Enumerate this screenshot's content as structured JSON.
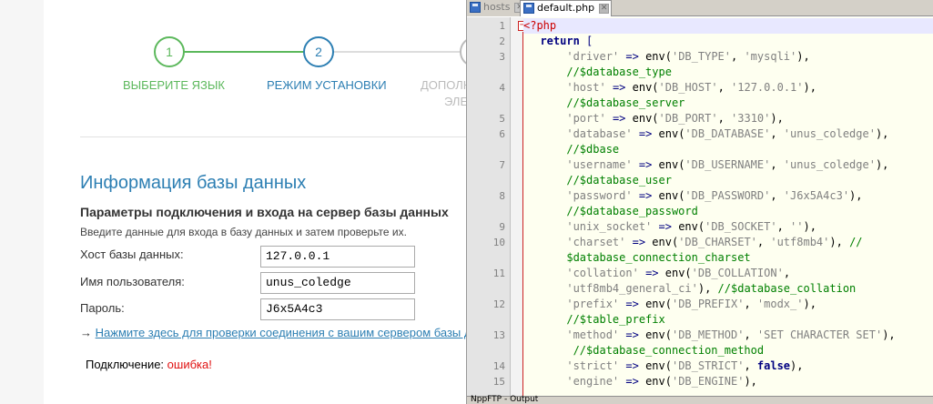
{
  "installer": {
    "steps": [
      {
        "number": "1",
        "label": "ВЫБЕРИТЕ ЯЗЫК",
        "state": "done",
        "color": "#5cb85c"
      },
      {
        "number": "2",
        "label": "РЕЖИМ УСТАНОВКИ",
        "state": "current",
        "color": "#2d7fb3"
      },
      {
        "number": "",
        "label": "ДОПОЛН",
        "label_line2": "ЭЛЕ",
        "state": "pending",
        "color": "#bbbbbb"
      }
    ],
    "section_title": "Информация базы данных",
    "section_subtitle": "Параметры подключения и входа на сервер базы данных",
    "section_description": "Введите данные для входа в базу данных и затем проверьте их.",
    "fields": [
      {
        "label": "Хост базы данных:",
        "value": "127.0.0.1"
      },
      {
        "label": "Имя пользователя:",
        "value": "unus_coledge"
      },
      {
        "label": "Пароль:",
        "value": "J6x5A4c3"
      }
    ],
    "check_arrow": "→",
    "check_link": "Нажмите здесь для проверки соединения с вашим сервером базы дан",
    "status_label": "Подключение:",
    "status_value": "ошибка!",
    "status_color": "#e01010"
  },
  "editor": {
    "tabs": [
      {
        "name": "hosts",
        "active": false
      },
      {
        "name": "default.php",
        "active": true
      }
    ],
    "close_glyph": "✕",
    "fold_glyph": "−",
    "lines": [
      {
        "num": "1",
        "tokens": [
          [
            "t-tag",
            "<?php"
          ]
        ]
      },
      {
        "num": "2",
        "tokens": [
          [
            "t-plain",
            "  "
          ],
          [
            "t-kw",
            "return"
          ],
          [
            "t-plain",
            " "
          ],
          [
            "t-op",
            "["
          ]
        ]
      },
      {
        "num": "3",
        "tokens": [
          [
            "t-plain",
            "      "
          ],
          [
            "t-str",
            "'driver'"
          ],
          [
            "t-plain",
            " "
          ],
          [
            "t-op",
            "=>"
          ],
          [
            "t-plain",
            " env("
          ],
          [
            "t-str",
            "'DB_TYPE'"
          ],
          [
            "t-plain",
            ", "
          ],
          [
            "t-str",
            "'mysqli'"
          ],
          [
            "t-plain",
            "),"
          ]
        ]
      },
      {
        "num": "",
        "tokens": [
          [
            "t-plain",
            "      "
          ],
          [
            "t-cmt",
            "//$database_type"
          ]
        ]
      },
      {
        "num": "4",
        "tokens": [
          [
            "t-plain",
            "      "
          ],
          [
            "t-str",
            "'host'"
          ],
          [
            "t-plain",
            " "
          ],
          [
            "t-op",
            "=>"
          ],
          [
            "t-plain",
            " env("
          ],
          [
            "t-str",
            "'DB_HOST'"
          ],
          [
            "t-plain",
            ", "
          ],
          [
            "t-str",
            "'127.0.0.1'"
          ],
          [
            "t-plain",
            "),"
          ]
        ]
      },
      {
        "num": "",
        "tokens": [
          [
            "t-plain",
            "      "
          ],
          [
            "t-cmt",
            "//$database_server"
          ]
        ]
      },
      {
        "num": "5",
        "tokens": [
          [
            "t-plain",
            "      "
          ],
          [
            "t-str",
            "'port'"
          ],
          [
            "t-plain",
            " "
          ],
          [
            "t-op",
            "=>"
          ],
          [
            "t-plain",
            " env("
          ],
          [
            "t-str",
            "'DB_PORT'"
          ],
          [
            "t-plain",
            ", "
          ],
          [
            "t-str",
            "'3310'"
          ],
          [
            "t-plain",
            "),"
          ]
        ]
      },
      {
        "num": "6",
        "tokens": [
          [
            "t-plain",
            "      "
          ],
          [
            "t-str",
            "'database'"
          ],
          [
            "t-plain",
            " "
          ],
          [
            "t-op",
            "=>"
          ],
          [
            "t-plain",
            " env("
          ],
          [
            "t-str",
            "'DB_DATABASE'"
          ],
          [
            "t-plain",
            ", "
          ],
          [
            "t-str",
            "'unus_coledge'"
          ],
          [
            "t-plain",
            "),"
          ]
        ]
      },
      {
        "num": "",
        "tokens": [
          [
            "t-plain",
            "      "
          ],
          [
            "t-cmt",
            "//$dbase"
          ]
        ]
      },
      {
        "num": "7",
        "tokens": [
          [
            "t-plain",
            "      "
          ],
          [
            "t-str",
            "'username'"
          ],
          [
            "t-plain",
            " "
          ],
          [
            "t-op",
            "=>"
          ],
          [
            "t-plain",
            " env("
          ],
          [
            "t-str",
            "'DB_USERNAME'"
          ],
          [
            "t-plain",
            ", "
          ],
          [
            "t-str",
            "'unus_coledge'"
          ],
          [
            "t-plain",
            "),"
          ]
        ]
      },
      {
        "num": "",
        "tokens": [
          [
            "t-plain",
            "      "
          ],
          [
            "t-cmt",
            "//$database_user"
          ]
        ]
      },
      {
        "num": "8",
        "tokens": [
          [
            "t-plain",
            "      "
          ],
          [
            "t-str",
            "'password'"
          ],
          [
            "t-plain",
            " "
          ],
          [
            "t-op",
            "=>"
          ],
          [
            "t-plain",
            " env("
          ],
          [
            "t-str",
            "'DB_PASSWORD'"
          ],
          [
            "t-plain",
            ", "
          ],
          [
            "t-str",
            "'J6x5A4c3'"
          ],
          [
            "t-plain",
            "),"
          ]
        ]
      },
      {
        "num": "",
        "tokens": [
          [
            "t-plain",
            "      "
          ],
          [
            "t-cmt",
            "//$database_password"
          ]
        ]
      },
      {
        "num": "9",
        "tokens": [
          [
            "t-plain",
            "      "
          ],
          [
            "t-str",
            "'unix_socket'"
          ],
          [
            "t-plain",
            " "
          ],
          [
            "t-op",
            "=>"
          ],
          [
            "t-plain",
            " env("
          ],
          [
            "t-str",
            "'DB_SOCKET'"
          ],
          [
            "t-plain",
            ", "
          ],
          [
            "t-str",
            "''"
          ],
          [
            "t-plain",
            "),"
          ]
        ]
      },
      {
        "num": "10",
        "tokens": [
          [
            "t-plain",
            "      "
          ],
          [
            "t-str",
            "'charset'"
          ],
          [
            "t-plain",
            " "
          ],
          [
            "t-op",
            "=>"
          ],
          [
            "t-plain",
            " env("
          ],
          [
            "t-str",
            "'DB_CHARSET'"
          ],
          [
            "t-plain",
            ", "
          ],
          [
            "t-str",
            "'utf8mb4'"
          ],
          [
            "t-plain",
            "), "
          ],
          [
            "t-cmt",
            "//"
          ]
        ]
      },
      {
        "num": "",
        "tokens": [
          [
            "t-plain",
            "      "
          ],
          [
            "t-cmt",
            "$database_connection_charset"
          ]
        ]
      },
      {
        "num": "11",
        "tokens": [
          [
            "t-plain",
            "      "
          ],
          [
            "t-str",
            "'collation'"
          ],
          [
            "t-plain",
            " "
          ],
          [
            "t-op",
            "=>"
          ],
          [
            "t-plain",
            " env("
          ],
          [
            "t-str",
            "'DB_COLLATION'"
          ],
          [
            "t-plain",
            ","
          ]
        ]
      },
      {
        "num": "",
        "tokens": [
          [
            "t-plain",
            "      "
          ],
          [
            "t-str",
            "'utf8mb4_general_ci'"
          ],
          [
            "t-plain",
            "), "
          ],
          [
            "t-cmt",
            "//$database_collation"
          ]
        ]
      },
      {
        "num": "12",
        "tokens": [
          [
            "t-plain",
            "      "
          ],
          [
            "t-str",
            "'prefix'"
          ],
          [
            "t-plain",
            " "
          ],
          [
            "t-op",
            "=>"
          ],
          [
            "t-plain",
            " env("
          ],
          [
            "t-str",
            "'DB_PREFIX'"
          ],
          [
            "t-plain",
            ", "
          ],
          [
            "t-str",
            "'modx_'"
          ],
          [
            "t-plain",
            "),"
          ]
        ]
      },
      {
        "num": "",
        "tokens": [
          [
            "t-plain",
            "      "
          ],
          [
            "t-cmt",
            "//$table_prefix"
          ]
        ]
      },
      {
        "num": "13",
        "tokens": [
          [
            "t-plain",
            "      "
          ],
          [
            "t-str",
            "'method'"
          ],
          [
            "t-plain",
            " "
          ],
          [
            "t-op",
            "=>"
          ],
          [
            "t-plain",
            " env("
          ],
          [
            "t-str",
            "'DB_METHOD'"
          ],
          [
            "t-plain",
            ", "
          ],
          [
            "t-str",
            "'SET CHARACTER SET'"
          ],
          [
            "t-plain",
            "),"
          ]
        ]
      },
      {
        "num": "",
        "tokens": [
          [
            "t-plain",
            "       "
          ],
          [
            "t-cmt",
            "//$database_connection_method"
          ]
        ]
      },
      {
        "num": "14",
        "tokens": [
          [
            "t-plain",
            "      "
          ],
          [
            "t-str",
            "'strict'"
          ],
          [
            "t-plain",
            " "
          ],
          [
            "t-op",
            "=>"
          ],
          [
            "t-plain",
            " env("
          ],
          [
            "t-str",
            "'DB_STRICT'"
          ],
          [
            "t-plain",
            ", "
          ],
          [
            "t-kw",
            "false"
          ],
          [
            "t-plain",
            "),"
          ]
        ]
      },
      {
        "num": "15",
        "tokens": [
          [
            "t-plain",
            "      "
          ],
          [
            "t-str",
            "'engine'"
          ],
          [
            "t-plain",
            " "
          ],
          [
            "t-op",
            "=>"
          ],
          [
            "t-plain",
            " env("
          ],
          [
            "t-str",
            "'DB_ENGINE'"
          ],
          [
            "t-plain",
            "),"
          ]
        ]
      }
    ],
    "output_label": "NppFTP - Output"
  }
}
